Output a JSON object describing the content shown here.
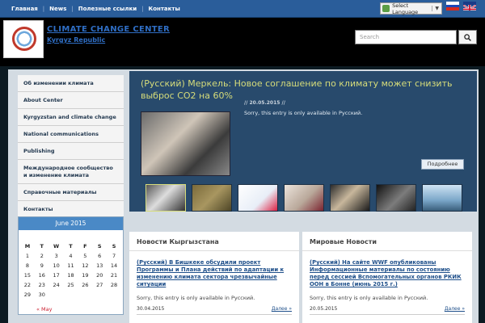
{
  "topnav": [
    "Главная",
    "News",
    "Полезные ссылки",
    "Контакты"
  ],
  "language": {
    "label": "Select Language",
    "arrow": "▼"
  },
  "header": {
    "title": "CLIMATE CHANGE CENTER",
    "subtitle": "Kyrgyz Republic"
  },
  "search": {
    "placeholder": "Search"
  },
  "sidebar": {
    "items": [
      "Об изменении климата",
      "About Center",
      "Kyrgyzstan and climate change",
      "National communications",
      "Publishing",
      "Международное сообщество и изменение климата",
      "Справочные материалы",
      "Контакты"
    ]
  },
  "calendar": {
    "title": "June 2015",
    "day_headers": [
      "M",
      "T",
      "W",
      "T",
      "F",
      "S",
      "S"
    ],
    "days": [
      "1",
      "2",
      "3",
      "4",
      "5",
      "6",
      "7",
      "8",
      "9",
      "10",
      "11",
      "12",
      "13",
      "14",
      "15",
      "16",
      "17",
      "18",
      "19",
      "20",
      "21",
      "22",
      "23",
      "24",
      "25",
      "26",
      "27",
      "28",
      "29",
      "30"
    ],
    "prev_link": "« May"
  },
  "featured": {
    "title": "(Русский) Меркель: Новое соглашение по климату может снизить выброс СО2 на 60%",
    "date": "// 20.05.2015 //",
    "text": "Sorry, this entry is only available in Русский.",
    "more_label": "Подробнее"
  },
  "news_kg": {
    "heading": "Новости Кыргызстана",
    "headline": "(Русский) В Бишкеке обсудили проект Программы и Плана действий по адаптации к изменению климата сектора чрезвычайные ситуации",
    "text": "Sorry, this entry is only available in Русский.",
    "date": "30.04.2015",
    "more": "Далее »"
  },
  "news_world": {
    "heading": "Мировые Новости",
    "headline": "(Русский) На сайте WWF опубликованы Информационные материалы по состоянию перед сессией Вспомогательных органов РКИК ООН в Бонне (июнь 2015 г.)",
    "text": "Sorry, this entry is only available in Русский.",
    "date": "20.05.2015",
    "more": "Далее »"
  },
  "colors": {
    "topbar": "#2a5d9a",
    "featured_bg": "#284a6c",
    "featured_title": "#d6dc7a",
    "link": "#1e4f8a"
  }
}
